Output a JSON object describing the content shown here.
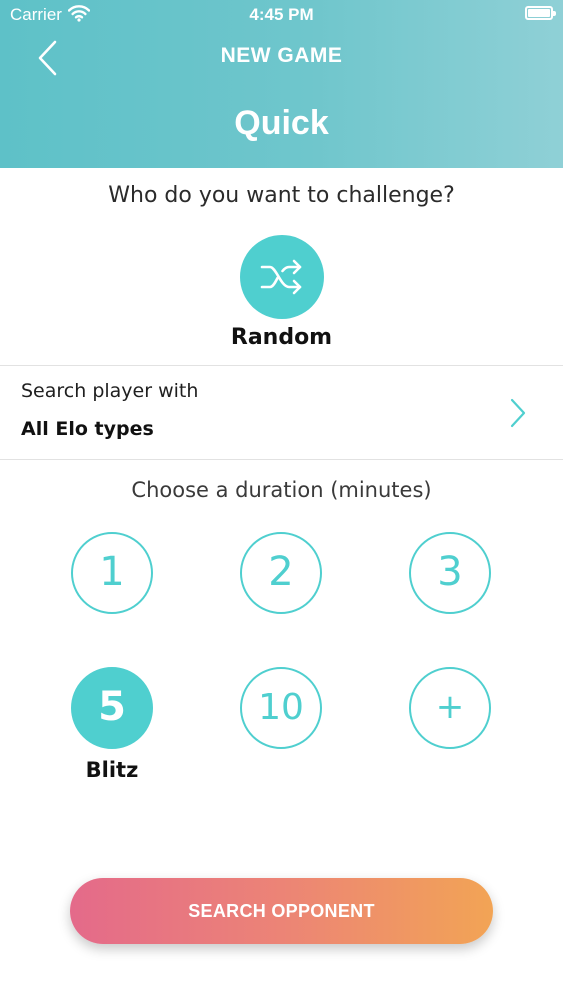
{
  "status_bar": {
    "carrier": "Carrier",
    "time": "4:45 PM"
  },
  "header": {
    "nav_title": "NEW GAME",
    "mode_title": "Quick"
  },
  "challenge": {
    "prompt": "Who do you want to challenge?",
    "random_label": "Random"
  },
  "search_player": {
    "label": "Search player with",
    "value": "All Elo types"
  },
  "duration": {
    "prompt": "Choose a duration (minutes)",
    "options": [
      {
        "label": "1",
        "selected": false
      },
      {
        "label": "2",
        "selected": false
      },
      {
        "label": "3",
        "selected": false
      },
      {
        "label": "5",
        "selected": true
      },
      {
        "label": "10",
        "selected": false
      },
      {
        "label": "+",
        "selected": false
      }
    ],
    "selected_caption": "Blitz"
  },
  "actions": {
    "search_opponent": "SEARCH OPPONENT"
  },
  "colors": {
    "accent": "#4fcfcf",
    "header_start": "#5ec1c8",
    "header_end": "#8fd0d6",
    "button_start": "#e46a8a",
    "button_end": "#f2a455"
  },
  "icons": {
    "back": "chevron-left-icon",
    "random": "shuffle-icon",
    "disclosure": "chevron-right-icon",
    "wifi": "wifi-icon",
    "battery": "battery-icon"
  }
}
